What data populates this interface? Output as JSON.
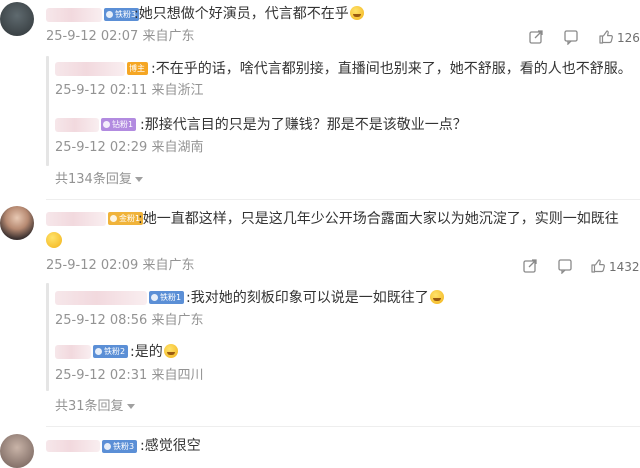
{
  "comments": [
    {
      "badge": "铁粉3",
      "text": ":她只想做个好演员，代言都不在乎",
      "meta": "25-9-12 02:07 来自广东",
      "like_count": "126",
      "replies": [
        {
          "badge": "博主",
          "text": ":不在乎的话，啥代言都别接，直播间也别来了，她不舒服，看的人也不舒服。",
          "meta": "25-9-12 02:11 来自浙江"
        },
        {
          "badge": "钻粉1",
          "text": ":那接代言目的只是为了赚钱？那是不是该敬业一点？",
          "meta": "25-9-12 02:29 来自湖南"
        }
      ],
      "more_replies": "共134条回复"
    },
    {
      "badge": "金粉1",
      "text": ":她一直都这样，只是这几年少公开场合露面大家以为她沉淀了，实则一如既往",
      "meta": "25-9-12 02:09 来自广东",
      "like_count": "1432",
      "replies": [
        {
          "badge": "铁粉1",
          "text": ":我对她的刻板印象可以说是一如既往了",
          "meta": "25-9-12 08:56 来自广东"
        },
        {
          "badge": "铁粉2",
          "text": ":是的",
          "meta": "25-9-12 02:31 来自四川"
        }
      ],
      "more_replies": "共31条回复"
    },
    {
      "badge": "铁粉3",
      "text": ":感觉很空"
    }
  ],
  "colors": {
    "badge_iron": "#5b8fd6",
    "badge_host": "#f5a623",
    "badge_diamond": "#b28be0",
    "badge_gold": "#f0b33a"
  },
  "icons": [
    "share-icon",
    "comment-icon",
    "like-icon"
  ]
}
